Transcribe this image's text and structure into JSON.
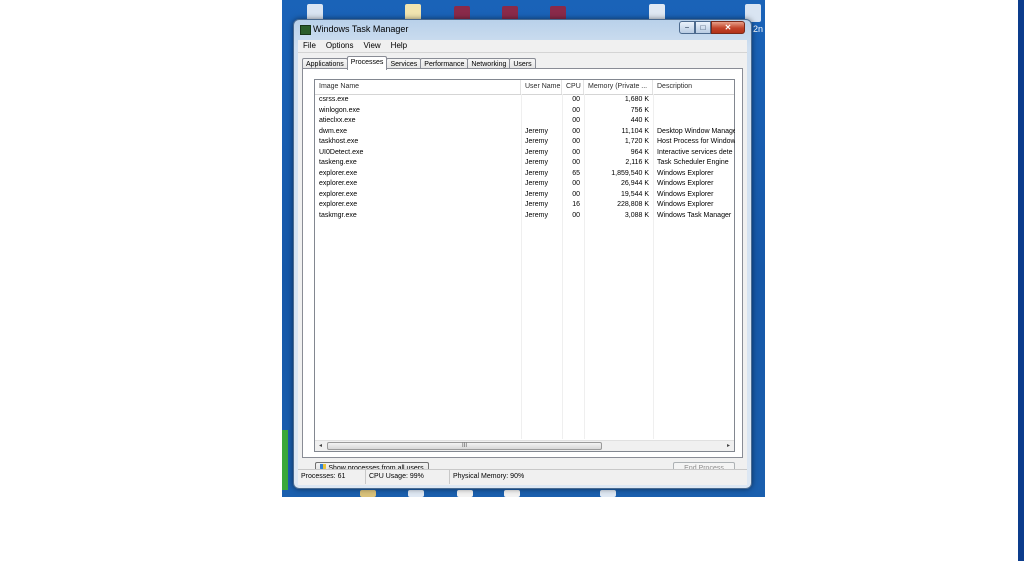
{
  "window": {
    "title": "Windows Task Manager",
    "caption_min": "−",
    "caption_max": "□",
    "caption_close": "✕"
  },
  "menu": [
    "File",
    "Options",
    "View",
    "Help"
  ],
  "tabs": [
    "Applications",
    "Processes",
    "Services",
    "Performance",
    "Networking",
    "Users"
  ],
  "active_tab": "Processes",
  "columns": [
    "Image Name",
    "User Name",
    "CPU",
    "Memory (Private ...",
    "Description"
  ],
  "processes": [
    {
      "image": "csrss.exe",
      "user": "",
      "cpu": "00",
      "mem": "1,680 K",
      "desc": ""
    },
    {
      "image": "winlogon.exe",
      "user": "",
      "cpu": "00",
      "mem": "756 K",
      "desc": ""
    },
    {
      "image": "atieclxx.exe",
      "user": "",
      "cpu": "00",
      "mem": "440 K",
      "desc": ""
    },
    {
      "image": "dwm.exe",
      "user": "Jeremy",
      "cpu": "00",
      "mem": "11,104 K",
      "desc": "Desktop Window Manager"
    },
    {
      "image": "taskhost.exe",
      "user": "Jeremy",
      "cpu": "00",
      "mem": "1,720 K",
      "desc": "Host Process for Windows"
    },
    {
      "image": "UI0Detect.exe",
      "user": "Jeremy",
      "cpu": "00",
      "mem": "964 K",
      "desc": "Interactive services dete"
    },
    {
      "image": "taskeng.exe",
      "user": "Jeremy",
      "cpu": "00",
      "mem": "2,116 K",
      "desc": "Task Scheduler Engine"
    },
    {
      "image": "explorer.exe",
      "user": "Jeremy",
      "cpu": "65",
      "mem": "1,859,540 K",
      "desc": "Windows Explorer"
    },
    {
      "image": "explorer.exe",
      "user": "Jeremy",
      "cpu": "00",
      "mem": "26,944 K",
      "desc": "Windows Explorer"
    },
    {
      "image": "explorer.exe",
      "user": "Jeremy",
      "cpu": "00",
      "mem": "19,544 K",
      "desc": "Windows Explorer"
    },
    {
      "image": "explorer.exe",
      "user": "Jeremy",
      "cpu": "16",
      "mem": "228,808 K",
      "desc": "Windows Explorer"
    },
    {
      "image": "taskmgr.exe",
      "user": "Jeremy",
      "cpu": "00",
      "mem": "3,088 K",
      "desc": "Windows Task Manager"
    }
  ],
  "scroll": {
    "left": "◂",
    "right": "▸",
    "grip": "III"
  },
  "buttons": {
    "show_all": "Show processes from all users",
    "end_process": "End Process"
  },
  "status": {
    "processes": "Processes: 61",
    "cpu": "CPU Usage: 99%",
    "memory": "Physical Memory: 90%"
  },
  "desktop": {
    "right_edge_label": "2n"
  },
  "colors": {
    "desktop_blue": "#1a63b8",
    "window_frame": "#cfdff0",
    "close_red": "#c2442a"
  }
}
